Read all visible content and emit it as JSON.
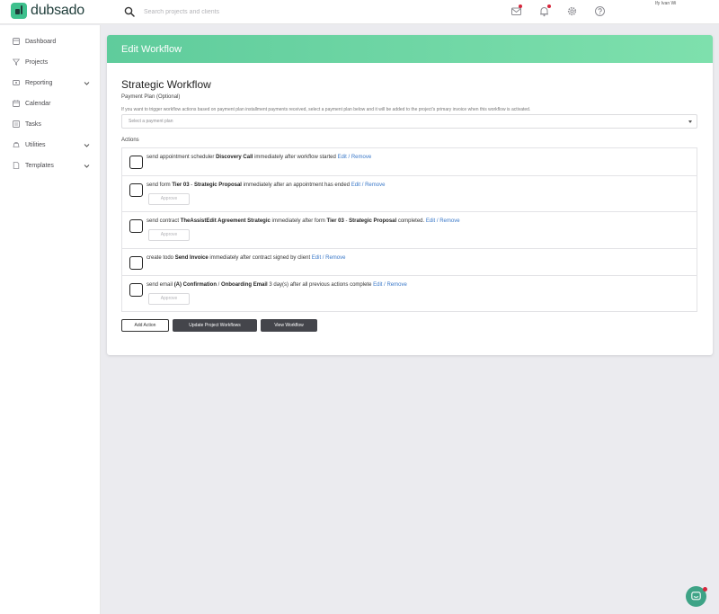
{
  "app": {
    "logo_text": "dubsado",
    "user_name": "Ify Ivan Wi",
    "accent": "#6fd6a4",
    "link_color": "#3a78c8",
    "alert_color": "#d6263c"
  },
  "search": {
    "placeholder": "Search projects and clients",
    "icon": "search-icon"
  },
  "topbar_icons": [
    "mail-icon",
    "bell-icon",
    "gear-icon",
    "help-icon"
  ],
  "sidebar": {
    "items": [
      {
        "label": "Dashboard",
        "icon": "dashboard-icon"
      },
      {
        "label": "Projects",
        "icon": "projects-icon"
      },
      {
        "label": "Reporting",
        "icon": "reporting-icon",
        "expandable": true
      },
      {
        "label": "Calendar",
        "icon": "calendar-icon"
      },
      {
        "label": "Tasks",
        "icon": "tasks-icon"
      },
      {
        "label": "Utilities",
        "icon": "utilities-icon",
        "expandable": true
      },
      {
        "label": "Templates",
        "icon": "templates-icon",
        "expandable": true
      }
    ]
  },
  "main": {
    "header_title": "Edit Workflow",
    "workflow_name": "Strategic Workflow",
    "payment_plan": {
      "label": "Payment Plan (Optional)",
      "help": "If you want to trigger workflow actions based on payment plan installment payments received, select a payment plan below and it will be added to the project's primary invoice when this workflow is activated.",
      "placeholder": "Select a payment plan"
    },
    "actions_label": "Actions",
    "edit_label": "Edit",
    "remove_label": "Remove",
    "approve_label": "Approve",
    "actions": [
      {
        "pre": "send appointment scheduler",
        "b1": "Discovery Call",
        "post": "immediately after workflow started"
      },
      {
        "pre": "send form",
        "b1": "Tier 03",
        "sep": " - ",
        "b2": "Strategic Proposal",
        "post": "immediately after an appointment has ended"
      },
      {
        "pre": "send contract",
        "b1": "TheAssistEdit Agreement Strategic",
        "mid": "immediately after form",
        "b2": "Tier 03",
        "sep": " - ",
        "b3": "Strategic Proposal",
        "post": "completed."
      },
      {
        "pre": "create todo",
        "b1": "Send Invoice",
        "post": "immediately after contract signed by client"
      },
      {
        "pre": "send email",
        "b1": "(A) Confirmation",
        "sep": " / ",
        "b2": "Onboarding Email",
        "post": "3 day(s) after all previous actions complete"
      }
    ],
    "buttons": {
      "add_action": "Add Action",
      "update_workflows": "Update Project Workflows",
      "view_workflow": "View Workflow"
    }
  },
  "chat": {
    "icon": "chat-icon"
  }
}
